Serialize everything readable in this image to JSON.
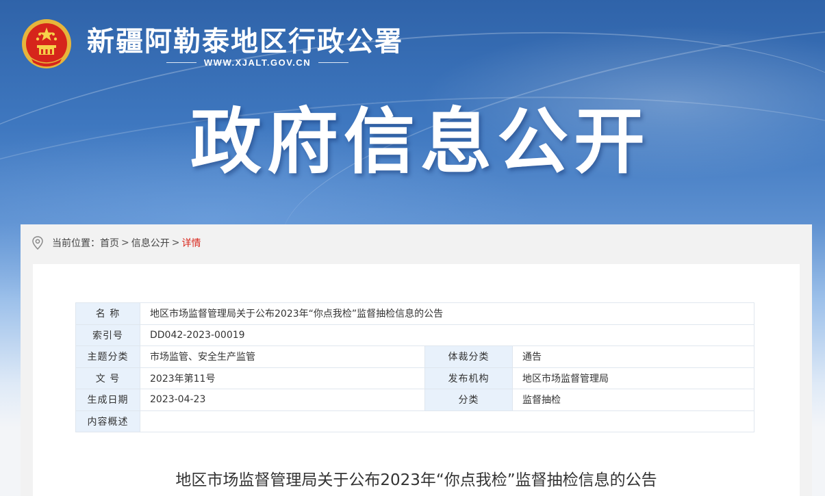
{
  "header": {
    "site_title": "新疆阿勒泰地区行政公署",
    "site_url": "WWW.XJALT.GOV.CN",
    "hero_title": "政府信息公开"
  },
  "breadcrumb": {
    "prefix": "当前位置：",
    "items": [
      "首页",
      "信息公开",
      "详情"
    ],
    "separator": ">"
  },
  "info_table": {
    "name_label": "名 称",
    "name_value": "地区市场监督管理局关于公布2023年“你点我检”监督抽检信息的公告",
    "index_label": "索引号",
    "index_value": "DD042-2023-00019",
    "topic_label": "主题分类",
    "topic_value": "市场监管、安全生产监管",
    "genre_label": "体裁分类",
    "genre_value": "通告",
    "docno_label": "文 号",
    "docno_value": "2023年第11号",
    "publisher_label": "发布机构",
    "publisher_value": "地区市场监督管理局",
    "date_label": "生成日期",
    "date_value": "2023-04-23",
    "category_label": "分类",
    "category_value": "监督抽检",
    "summary_label": "内容概述",
    "summary_value": ""
  },
  "document": {
    "title": "地区市场监督管理局关于公布2023年“你点我检”监督抽检信息的公告"
  },
  "colors": {
    "banner_blue": "#2f63a9",
    "label_cell_bg": "#e8f1fb",
    "breadcrumb_current": "#d9261c"
  },
  "icons": {
    "emblem": "national-emblem-icon",
    "location": "location-pin-icon"
  }
}
